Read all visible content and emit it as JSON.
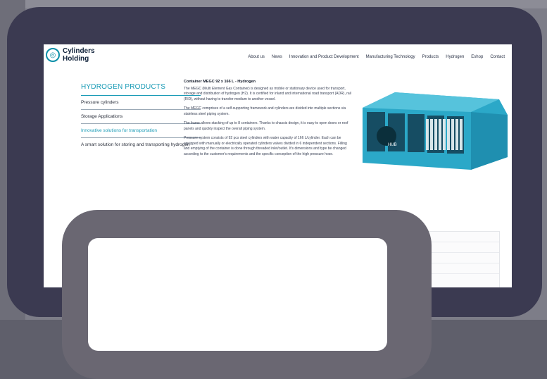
{
  "brand": {
    "name_line1": "Cylinders",
    "name_line2": "Holding"
  },
  "nav": [
    "About us",
    "News",
    "Innovation and Product Development",
    "Manufacturing Technology",
    "Products",
    "Hydrogen",
    "Eshop",
    "Contact"
  ],
  "sidebar": {
    "title": "HYDROGEN PRODUCTS",
    "items": [
      "Pressure cylinders",
      "Storage Applications",
      "Innovative solutions for transportation",
      "A smart solution for storing and transporting hydrogen"
    ],
    "active_index": 2
  },
  "article": {
    "title": "Container MEGC 92 x 166 L - Hydrogen",
    "paragraphs": [
      "The MEGC (Multi Element Gas Container) is designed as mobile or stationary device used for transport, storage and distribution of hydrogen (H2). It is certified for inland and international road transport (ADR), rail (RID), without having to transfer medium to another vessel.",
      "The MEGC comprises of a self-supporting framework and cylinders are divided into multiple sections via stainless steel piping system.",
      "The frame allows stacking of up to 8 containers. Thanks to chassis design, it is easy to open doors or roof panels and quickly inspect the overall piping system.",
      "Pressure system consists of 92 pcs steel cylinders with water capacity of 166 L/cylinder. Each can be equipped with manually or electrically operated cylinders valves divided in 6 independent sections. Filling and emptying of the container is done through threaded inlet/outlet. It's dimensions and type be changed according to the customer's requirements and the specific conception of the high pressure hose."
    ]
  },
  "image": {
    "label": "HUB"
  },
  "colors": {
    "accent": "#1a9bb6",
    "frame": "#3b3a51",
    "container": "#2ba8c8"
  }
}
